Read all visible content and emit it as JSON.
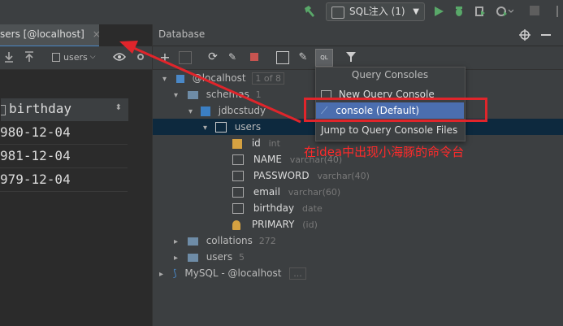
{
  "toolbar": {
    "run_config": "SQL注入 (1)",
    "icons": [
      "hammer-icon",
      "run-icon",
      "debug-icon",
      "coverage-icon",
      "profile-icon",
      "stop-icon"
    ]
  },
  "editor": {
    "tab_label": "sers [@localhost]",
    "datasource_select": "users",
    "column_header": "birthday",
    "rows": [
      "980-12-04",
      "981-12-04",
      "979-12-04"
    ]
  },
  "database": {
    "title": "Database",
    "tree": {
      "root": {
        "label": "@localhost",
        "badge": "1 of 8"
      },
      "schemas": {
        "label": "schemas",
        "count": "1"
      },
      "schema": {
        "label": "jdbcstudy"
      },
      "table": {
        "label": "users"
      },
      "columns": [
        {
          "name": "id",
          "type": "int"
        },
        {
          "name": "NAME",
          "type": "varchar(40)"
        },
        {
          "name": "PASSWORD",
          "type": "varchar(40)"
        },
        {
          "name": "email",
          "type": "varchar(60)"
        },
        {
          "name": "birthday",
          "type": "date"
        },
        {
          "name": "PRIMARY",
          "type": "(id)"
        }
      ],
      "collations": {
        "label": "collations",
        "count": "272"
      },
      "users": {
        "label": "users",
        "count": "5"
      },
      "mysql": {
        "label": "MySQL - @localhost",
        "badge": "..."
      }
    }
  },
  "popup": {
    "title": "Query Consoles",
    "items": [
      "New Query Console",
      "console (Default)",
      "Jump to Query Console Files"
    ]
  },
  "annotation": {
    "text": "在idea中出现小海豚的命令台",
    "color": "#ff2a2a"
  }
}
